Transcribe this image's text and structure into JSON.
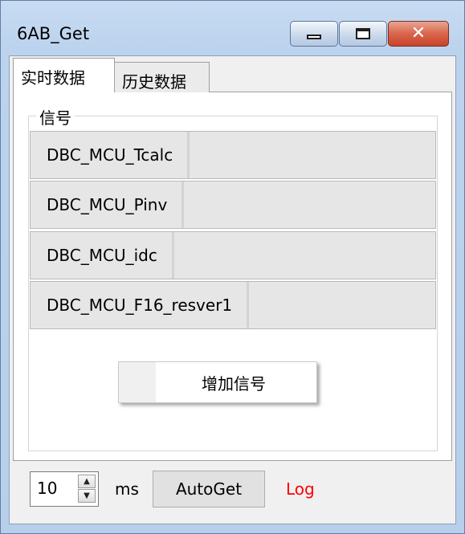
{
  "window": {
    "title": "6AB_Get",
    "controls": {
      "minimize": "minimize-icon",
      "maximize": "maximize-icon",
      "close": "close-icon",
      "close_glyph": "✕"
    }
  },
  "tabs": [
    {
      "label": "实时数据",
      "active": true
    },
    {
      "label": "历史数据",
      "active": false
    }
  ],
  "signal_group": {
    "title": "信号",
    "rows": [
      {
        "name": "DBC_MCU_Tcalc",
        "value": ""
      },
      {
        "name": "DBC_MCU_Pinv",
        "value": ""
      },
      {
        "name": "DBC_MCU_idc",
        "value": ""
      },
      {
        "name": "DBC_MCU_F16_resver1",
        "value": ""
      }
    ],
    "add_button": "增加信号"
  },
  "footer": {
    "interval_value": "10",
    "spin_up_glyph": "▲",
    "spin_down_glyph": "▼",
    "unit": "ms",
    "autoget_button": "AutoGet",
    "log_link": "Log"
  },
  "colors": {
    "log": "#ff0000",
    "title_bar": "#bcd3ee",
    "close_button": "#c7442a"
  }
}
